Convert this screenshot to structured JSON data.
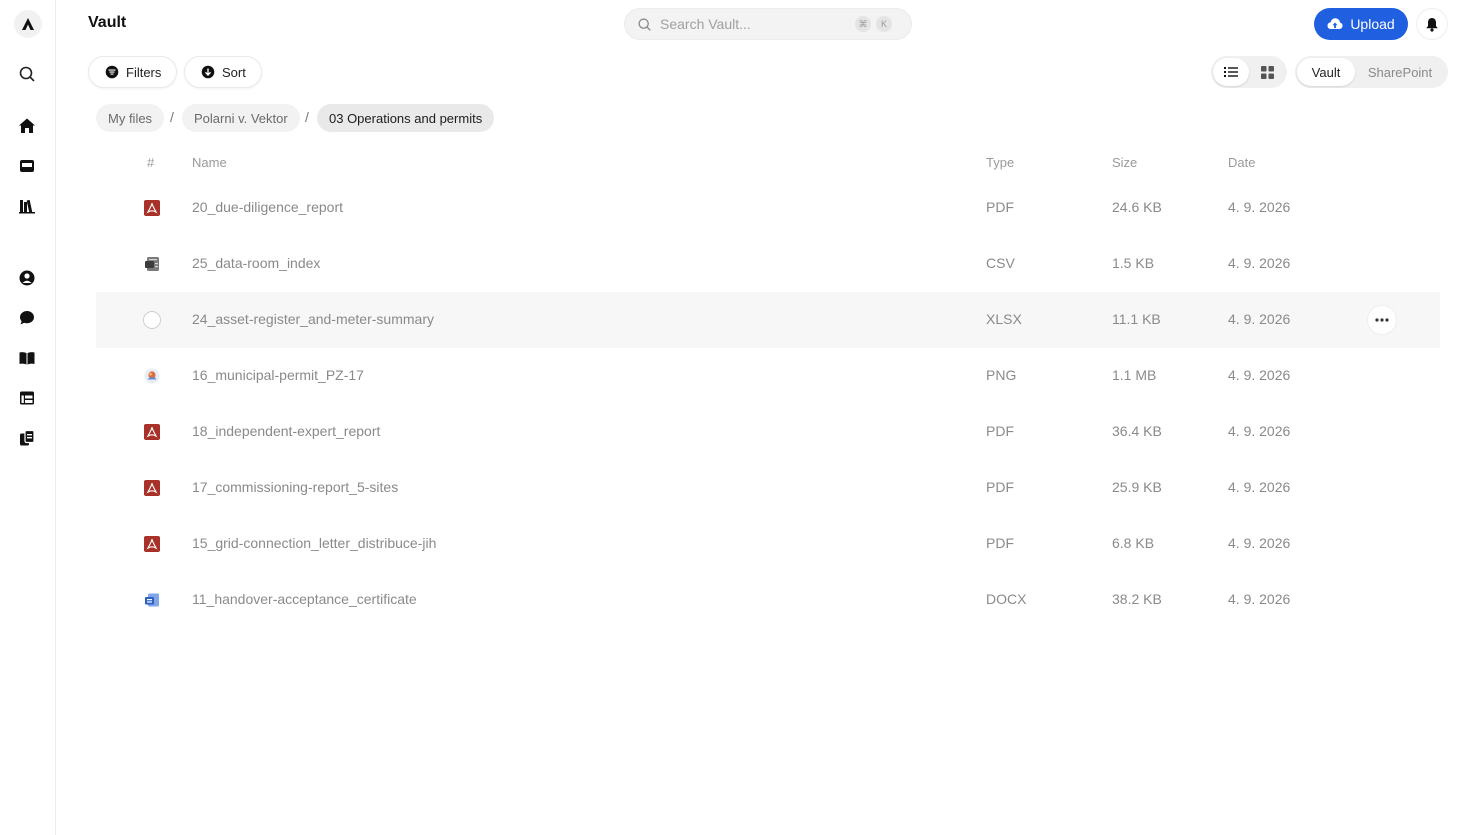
{
  "header": {
    "title": "Vault",
    "search_placeholder": "Search Vault...",
    "shortcut_cmd": "⌘",
    "shortcut_key": "K",
    "upload_label": "Upload"
  },
  "toolbar": {
    "filters_label": "Filters",
    "sort_label": "Sort",
    "view_mode": "list",
    "source_tabs": [
      "Vault",
      "SharePoint"
    ],
    "active_source": "Vault"
  },
  "breadcrumb": [
    "My files",
    "Polarni v. Vektor",
    "03 Operations and permits"
  ],
  "table": {
    "columns": {
      "index": "#",
      "name": "Name",
      "type": "Type",
      "size": "Size",
      "date": "Date"
    },
    "rows": [
      {
        "name": "20_due-diligence_report",
        "type": "PDF",
        "size": "24.6 KB",
        "date": "4. 9. 2026",
        "icon": "pdf-icon"
      },
      {
        "name": "25_data-room_index",
        "type": "CSV",
        "size": "1.5 KB",
        "date": "4. 9. 2026",
        "icon": "csv-icon"
      },
      {
        "name": "24_asset-register_and-meter-summary",
        "type": "XLSX",
        "size": "11.1 KB",
        "date": "4. 9. 2026",
        "icon": "select-radio",
        "hovered": true
      },
      {
        "name": "16_municipal-permit_PZ-17",
        "type": "PNG",
        "size": "1.1 MB",
        "date": "4. 9. 2026",
        "icon": "image-icon"
      },
      {
        "name": "18_independent-expert_report",
        "type": "PDF",
        "size": "36.4 KB",
        "date": "4. 9. 2026",
        "icon": "pdf-icon"
      },
      {
        "name": "17_commissioning-report_5-sites",
        "type": "PDF",
        "size": "25.9 KB",
        "date": "4. 9. 2026",
        "icon": "pdf-icon"
      },
      {
        "name": "15_grid-connection_letter_distribuce-jih",
        "type": "PDF",
        "size": "6.8 KB",
        "date": "4. 9. 2026",
        "icon": "pdf-icon"
      },
      {
        "name": "11_handover-acceptance_certificate",
        "type": "DOCX",
        "size": "38.2 KB",
        "date": "4. 9. 2026",
        "icon": "docx-icon"
      }
    ]
  },
  "colors": {
    "accent": "#1f5fe0",
    "pdf": "#a8322a",
    "docx": "#2f5fc4",
    "row_hover": "#f7f7f7"
  }
}
